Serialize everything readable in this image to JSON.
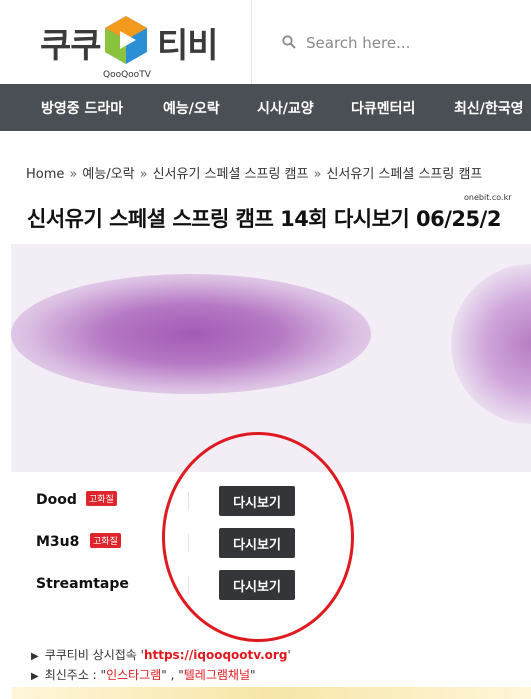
{
  "header": {
    "logo_left": "쿠쿠",
    "logo_right": "티비",
    "logo_sub": "QooQooTV",
    "search_placeholder": "Search here..."
  },
  "nav": {
    "items": [
      "방영중 드라마",
      "예능/오락",
      "시사/교양",
      "다큐멘터리",
      "최신/한국영"
    ]
  },
  "breadcrumb": {
    "items": [
      "Home",
      "예능/오락",
      "신서유기 스페셜 스프링 캠프",
      "신서유기 스페셜 스프링 캠프"
    ],
    "separator": "»"
  },
  "page": {
    "title": "신서유기 스페셜 스프링 캠프 14회 다시보기 06/25/2",
    "watermark": "onebit.co.kr"
  },
  "servers": [
    {
      "name": "Dood",
      "badge": "고화질",
      "button": "다시보기"
    },
    {
      "name": "M3u8",
      "badge": "고화질",
      "button": "다시보기"
    },
    {
      "name": "Streamtape",
      "badge": "",
      "button": "다시보기"
    }
  ],
  "notices": {
    "line1_prefix": "쿠쿠티비 상시접속 '",
    "line1_link": "https://iqooqootv.org",
    "line1_suffix": "'",
    "line2_prefix": "최신주소 : \"",
    "line2_link1": "인스타그램",
    "line2_mid": "\" , \"",
    "line2_link2": "텔레그램채널",
    "line2_suffix": "\""
  },
  "colors": {
    "nav_bg": "#4a4f55",
    "button_bg": "#333539",
    "badge_red": "#e0242b",
    "circle_red": "#e0191f",
    "logo_orange": "#f39a1e",
    "logo_blue": "#2b8fd6"
  },
  "icons": {
    "search": "search-icon",
    "logo_mark": "play-icon"
  }
}
